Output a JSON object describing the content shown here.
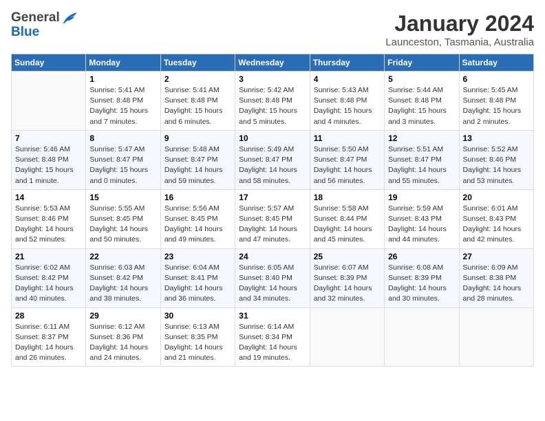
{
  "header": {
    "logo_general": "General",
    "logo_blue": "Blue",
    "month_year": "January 2024",
    "location": "Launceston, Tasmania, Australia"
  },
  "weekdays": [
    "Sunday",
    "Monday",
    "Tuesday",
    "Wednesday",
    "Thursday",
    "Friday",
    "Saturday"
  ],
  "weeks": [
    [
      {
        "day": "",
        "info": ""
      },
      {
        "day": "1",
        "info": "Sunrise: 5:41 AM\nSunset: 8:48 PM\nDaylight: 15 hours\nand 7 minutes."
      },
      {
        "day": "2",
        "info": "Sunrise: 5:41 AM\nSunset: 8:48 PM\nDaylight: 15 hours\nand 6 minutes."
      },
      {
        "day": "3",
        "info": "Sunrise: 5:42 AM\nSunset: 8:48 PM\nDaylight: 15 hours\nand 5 minutes."
      },
      {
        "day": "4",
        "info": "Sunrise: 5:43 AM\nSunset: 8:48 PM\nDaylight: 15 hours\nand 4 minutes."
      },
      {
        "day": "5",
        "info": "Sunrise: 5:44 AM\nSunset: 8:48 PM\nDaylight: 15 hours\nand 3 minutes."
      },
      {
        "day": "6",
        "info": "Sunrise: 5:45 AM\nSunset: 8:48 PM\nDaylight: 15 hours\nand 2 minutes."
      }
    ],
    [
      {
        "day": "7",
        "info": "Sunrise: 5:46 AM\nSunset: 8:48 PM\nDaylight: 15 hours\nand 1 minute."
      },
      {
        "day": "8",
        "info": "Sunrise: 5:47 AM\nSunset: 8:47 PM\nDaylight: 15 hours\nand 0 minutes."
      },
      {
        "day": "9",
        "info": "Sunrise: 5:48 AM\nSunset: 8:47 PM\nDaylight: 14 hours\nand 59 minutes."
      },
      {
        "day": "10",
        "info": "Sunrise: 5:49 AM\nSunset: 8:47 PM\nDaylight: 14 hours\nand 58 minutes."
      },
      {
        "day": "11",
        "info": "Sunrise: 5:50 AM\nSunset: 8:47 PM\nDaylight: 14 hours\nand 56 minutes."
      },
      {
        "day": "12",
        "info": "Sunrise: 5:51 AM\nSunset: 8:47 PM\nDaylight: 14 hours\nand 55 minutes."
      },
      {
        "day": "13",
        "info": "Sunrise: 5:52 AM\nSunset: 8:46 PM\nDaylight: 14 hours\nand 53 minutes."
      }
    ],
    [
      {
        "day": "14",
        "info": "Sunrise: 5:53 AM\nSunset: 8:46 PM\nDaylight: 14 hours\nand 52 minutes."
      },
      {
        "day": "15",
        "info": "Sunrise: 5:55 AM\nSunset: 8:45 PM\nDaylight: 14 hours\nand 50 minutes."
      },
      {
        "day": "16",
        "info": "Sunrise: 5:56 AM\nSunset: 8:45 PM\nDaylight: 14 hours\nand 49 minutes."
      },
      {
        "day": "17",
        "info": "Sunrise: 5:57 AM\nSunset: 8:45 PM\nDaylight: 14 hours\nand 47 minutes."
      },
      {
        "day": "18",
        "info": "Sunrise: 5:58 AM\nSunset: 8:44 PM\nDaylight: 14 hours\nand 45 minutes."
      },
      {
        "day": "19",
        "info": "Sunrise: 5:59 AM\nSunset: 8:43 PM\nDaylight: 14 hours\nand 44 minutes."
      },
      {
        "day": "20",
        "info": "Sunrise: 6:01 AM\nSunset: 8:43 PM\nDaylight: 14 hours\nand 42 minutes."
      }
    ],
    [
      {
        "day": "21",
        "info": "Sunrise: 6:02 AM\nSunset: 8:42 PM\nDaylight: 14 hours\nand 40 minutes."
      },
      {
        "day": "22",
        "info": "Sunrise: 6:03 AM\nSunset: 8:42 PM\nDaylight: 14 hours\nand 38 minutes."
      },
      {
        "day": "23",
        "info": "Sunrise: 6:04 AM\nSunset: 8:41 PM\nDaylight: 14 hours\nand 36 minutes."
      },
      {
        "day": "24",
        "info": "Sunrise: 6:05 AM\nSunset: 8:40 PM\nDaylight: 14 hours\nand 34 minutes."
      },
      {
        "day": "25",
        "info": "Sunrise: 6:07 AM\nSunset: 8:39 PM\nDaylight: 14 hours\nand 32 minutes."
      },
      {
        "day": "26",
        "info": "Sunrise: 6:08 AM\nSunset: 8:39 PM\nDaylight: 14 hours\nand 30 minutes."
      },
      {
        "day": "27",
        "info": "Sunrise: 6:09 AM\nSunset: 8:38 PM\nDaylight: 14 hours\nand 28 minutes."
      }
    ],
    [
      {
        "day": "28",
        "info": "Sunrise: 6:11 AM\nSunset: 8:37 PM\nDaylight: 14 hours\nand 26 minutes."
      },
      {
        "day": "29",
        "info": "Sunrise: 6:12 AM\nSunset: 8:36 PM\nDaylight: 14 hours\nand 24 minutes."
      },
      {
        "day": "30",
        "info": "Sunrise: 6:13 AM\nSunset: 8:35 PM\nDaylight: 14 hours\nand 21 minutes."
      },
      {
        "day": "31",
        "info": "Sunrise: 6:14 AM\nSunset: 8:34 PM\nDaylight: 14 hours\nand 19 minutes."
      },
      {
        "day": "",
        "info": ""
      },
      {
        "day": "",
        "info": ""
      },
      {
        "day": "",
        "info": ""
      }
    ]
  ]
}
